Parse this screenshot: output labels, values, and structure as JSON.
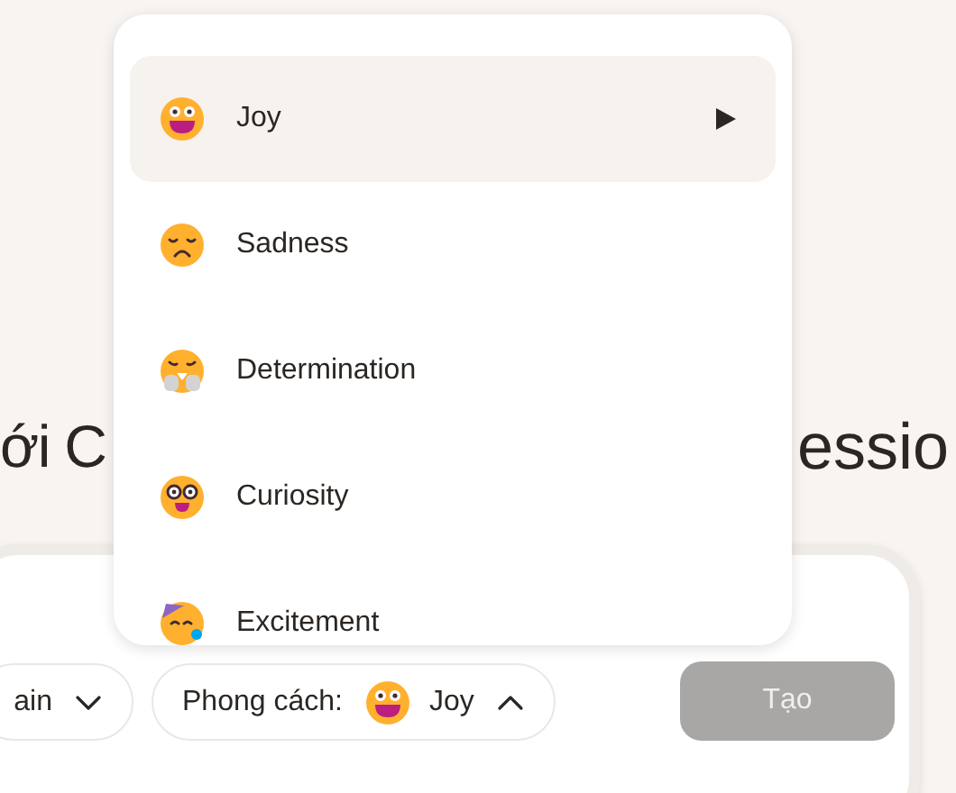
{
  "heading": {
    "left": "ới C",
    "right": "essio"
  },
  "menu": {
    "items": [
      {
        "label": "Joy",
        "selected": true
      },
      {
        "label": "Sadness",
        "selected": false
      },
      {
        "label": "Determination",
        "selected": false
      },
      {
        "label": "Curiosity",
        "selected": false
      },
      {
        "label": "Excitement",
        "selected": false
      }
    ]
  },
  "toolbar": {
    "pills": [
      {
        "kind": "select",
        "label": "ain",
        "expanded": false
      },
      {
        "kind": "style",
        "label": "Phong cách:",
        "value": "Joy",
        "expanded": true
      }
    ],
    "button": {
      "label": "Tạo",
      "disabled": true
    }
  }
}
